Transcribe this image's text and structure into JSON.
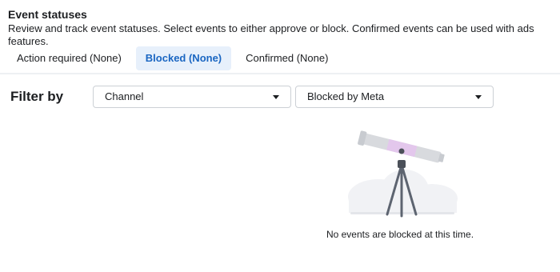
{
  "header": {
    "title": "Event statuses",
    "description": "Review and track event statuses. Select events to either approve or block. Confirmed events can be used with ads features."
  },
  "tabs": [
    {
      "label": "Action required (None)",
      "active": false
    },
    {
      "label": "Blocked (None)",
      "active": true
    },
    {
      "label": "Confirmed (None)",
      "active": false
    }
  ],
  "filter": {
    "label": "Filter by",
    "channel_select": {
      "value": "Channel",
      "icon": "caret-down-icon"
    },
    "status_select": {
      "value": "Blocked by Meta",
      "icon": "caret-down-icon"
    }
  },
  "empty_state": {
    "illustration": "telescope-illustration",
    "message": "No events are blocked at this time."
  },
  "colors": {
    "accent": "#1a66c2",
    "active_tab_bg": "#e7f0fb",
    "telescope_pink": "#e3c7ec"
  }
}
